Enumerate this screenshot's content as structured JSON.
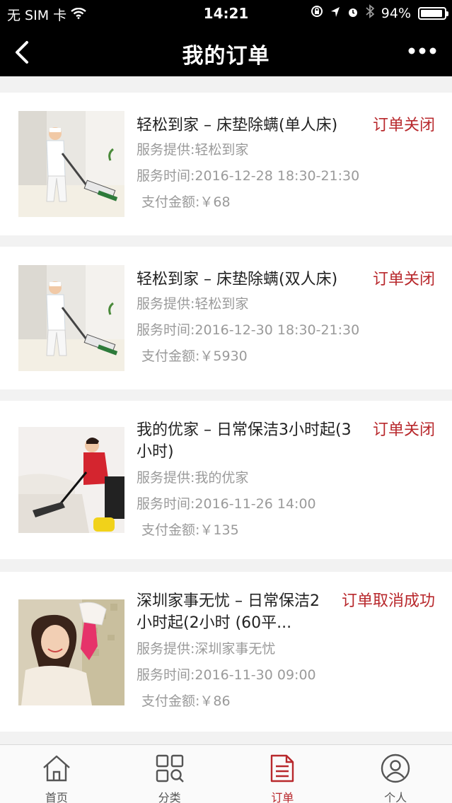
{
  "status_bar": {
    "carrier": "无 SIM 卡",
    "time": "14:21",
    "battery": "94%",
    "battery_level": 0.94
  },
  "nav": {
    "title": "我的订单",
    "back_icon": "chevron-left-icon",
    "more_icon": "more-dots-icon"
  },
  "orders": [
    {
      "title": "轻松到家 – 床垫除螨(单人床)",
      "status": "订单关闭",
      "provider": "服务提供:轻松到家",
      "service_time": "服务时间:2016-12-28 18:30-21:30",
      "payment": "支付金额:￥68"
    },
    {
      "title": "轻松到家 – 床垫除螨(双人床)",
      "status": "订单关闭",
      "provider": "服务提供:轻松到家",
      "service_time": "服务时间:2016-12-30 18:30-21:30",
      "payment": "支付金额:￥5930"
    },
    {
      "title": "我的优家 – 日常保洁3小时起(3小时)",
      "status": "订单关闭",
      "provider": "服务提供:我的优家",
      "service_time": "服务时间:2016-11-26 14:00",
      "payment": "支付金额:￥135"
    },
    {
      "title": "深圳家事无忧 – 日常保洁2小时起(2小时 (60平...",
      "status": "订单取消成功",
      "provider": "服务提供:深圳家事无忧",
      "service_time": "服务时间:2016-11-30 09:00",
      "payment": "支付金额:￥86"
    }
  ],
  "tabs": [
    {
      "label": "首页",
      "icon": "home-icon"
    },
    {
      "label": "分类",
      "icon": "category-grid-icon"
    },
    {
      "label": "订单",
      "icon": "order-document-icon",
      "active": true
    },
    {
      "label": "个人",
      "icon": "user-icon"
    }
  ],
  "colors": {
    "accent": "#b8282c",
    "header_bg": "#000000",
    "page_bg": "#f2f2f2"
  }
}
